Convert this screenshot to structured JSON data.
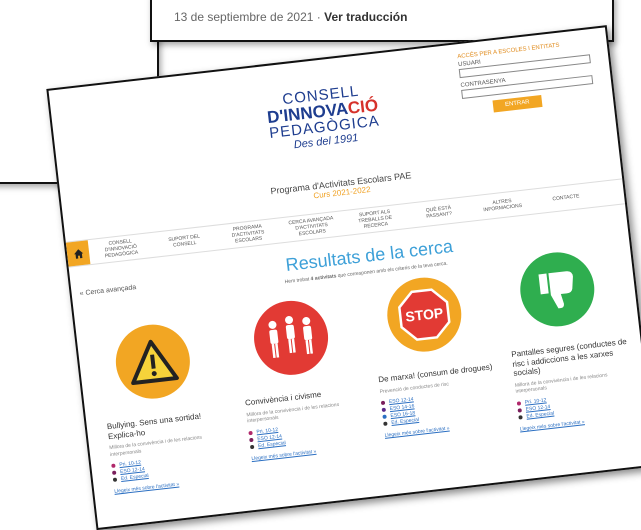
{
  "top_caption": {
    "date": "13 de septiembre de 2021",
    "separator": " · ",
    "link": "Ver traducción"
  },
  "logo": {
    "line1": "CONSELL",
    "line2a": "D'INNOVA",
    "line2b": "CIÓ",
    "line3": "PEDAGÒGICA",
    "line4": "Des del 1991"
  },
  "login": {
    "access": "ACCÉS PER A ESCOLES I ENTITATS",
    "user_label": "USUARI",
    "password_label": "CONTRASENYA",
    "enter": "ENTRAR"
  },
  "program": {
    "title": "Programa d'Activitats Escolars PAE",
    "year": "Curs 2021-2022"
  },
  "nav": {
    "items": [
      "CONSELL D'INNOVACIÓ PEDAGÒGICA",
      "SUPORT DEL CONSELL",
      "PROGRAMA D'ACTIVITATS ESCOLARS",
      "CERCA AVANÇADA D'ACTIVITATS ESCOLARS",
      "SUPORT ALS TREBALLS DE RECERCA",
      "QUÈ ESTÀ PASSANT?",
      "ALTRES INFORMACIONS",
      "CONTACTE"
    ]
  },
  "back_link": "« Cerca avançada",
  "results": {
    "title": "Resultats de la cerca",
    "subtitle_pre": "Hem trobat ",
    "subtitle_count": "4 activitats",
    "subtitle_post": " que corresponen amb els criteris de la teva cerca."
  },
  "cards": [
    {
      "title": "Bullying. Sens una sortida! Explica-ho",
      "desc": "Millora de la convivència i de les relacions interpersonals",
      "levels": [
        "Pri. 10-12",
        "ESO 12-14",
        "Ed. Especial"
      ],
      "more": "Llegeix més sobre l'activitat »",
      "color": "#f2a623"
    },
    {
      "title": "Convivència i civisme",
      "desc": "Millora de la convivència i de les relacions interpersonals",
      "levels": [
        "Pri. 10-12",
        "ESO 12-14",
        "Ed. Especial"
      ],
      "more": "Llegeix més sobre l'activitat »",
      "color": "#e23a34"
    },
    {
      "title": "De marxa! (consum de drogues)",
      "desc": "Prevenció de conductes de risc",
      "levels": [
        "ESO 12-14",
        "ESO 14-16",
        "ESO 16-18",
        "Ed. Especial"
      ],
      "more": "Llegeix més sobre l'activitat »",
      "color": "#f2a623"
    },
    {
      "title": "Pantalles segures (conductes de risc i addiccions a les xarxes socials)",
      "desc": "Millora de la convivència i de les relacions interpersonals",
      "levels": [
        "Pri. 10-12",
        "ESO 12-14",
        "Ed. Especial"
      ],
      "more": "Llegeix més sobre l'activitat »",
      "color": "#2fae4f"
    }
  ],
  "level_colors": {
    "pri": "#b0286b",
    "eso": "#7a1f5c",
    "esp": "#333333"
  }
}
